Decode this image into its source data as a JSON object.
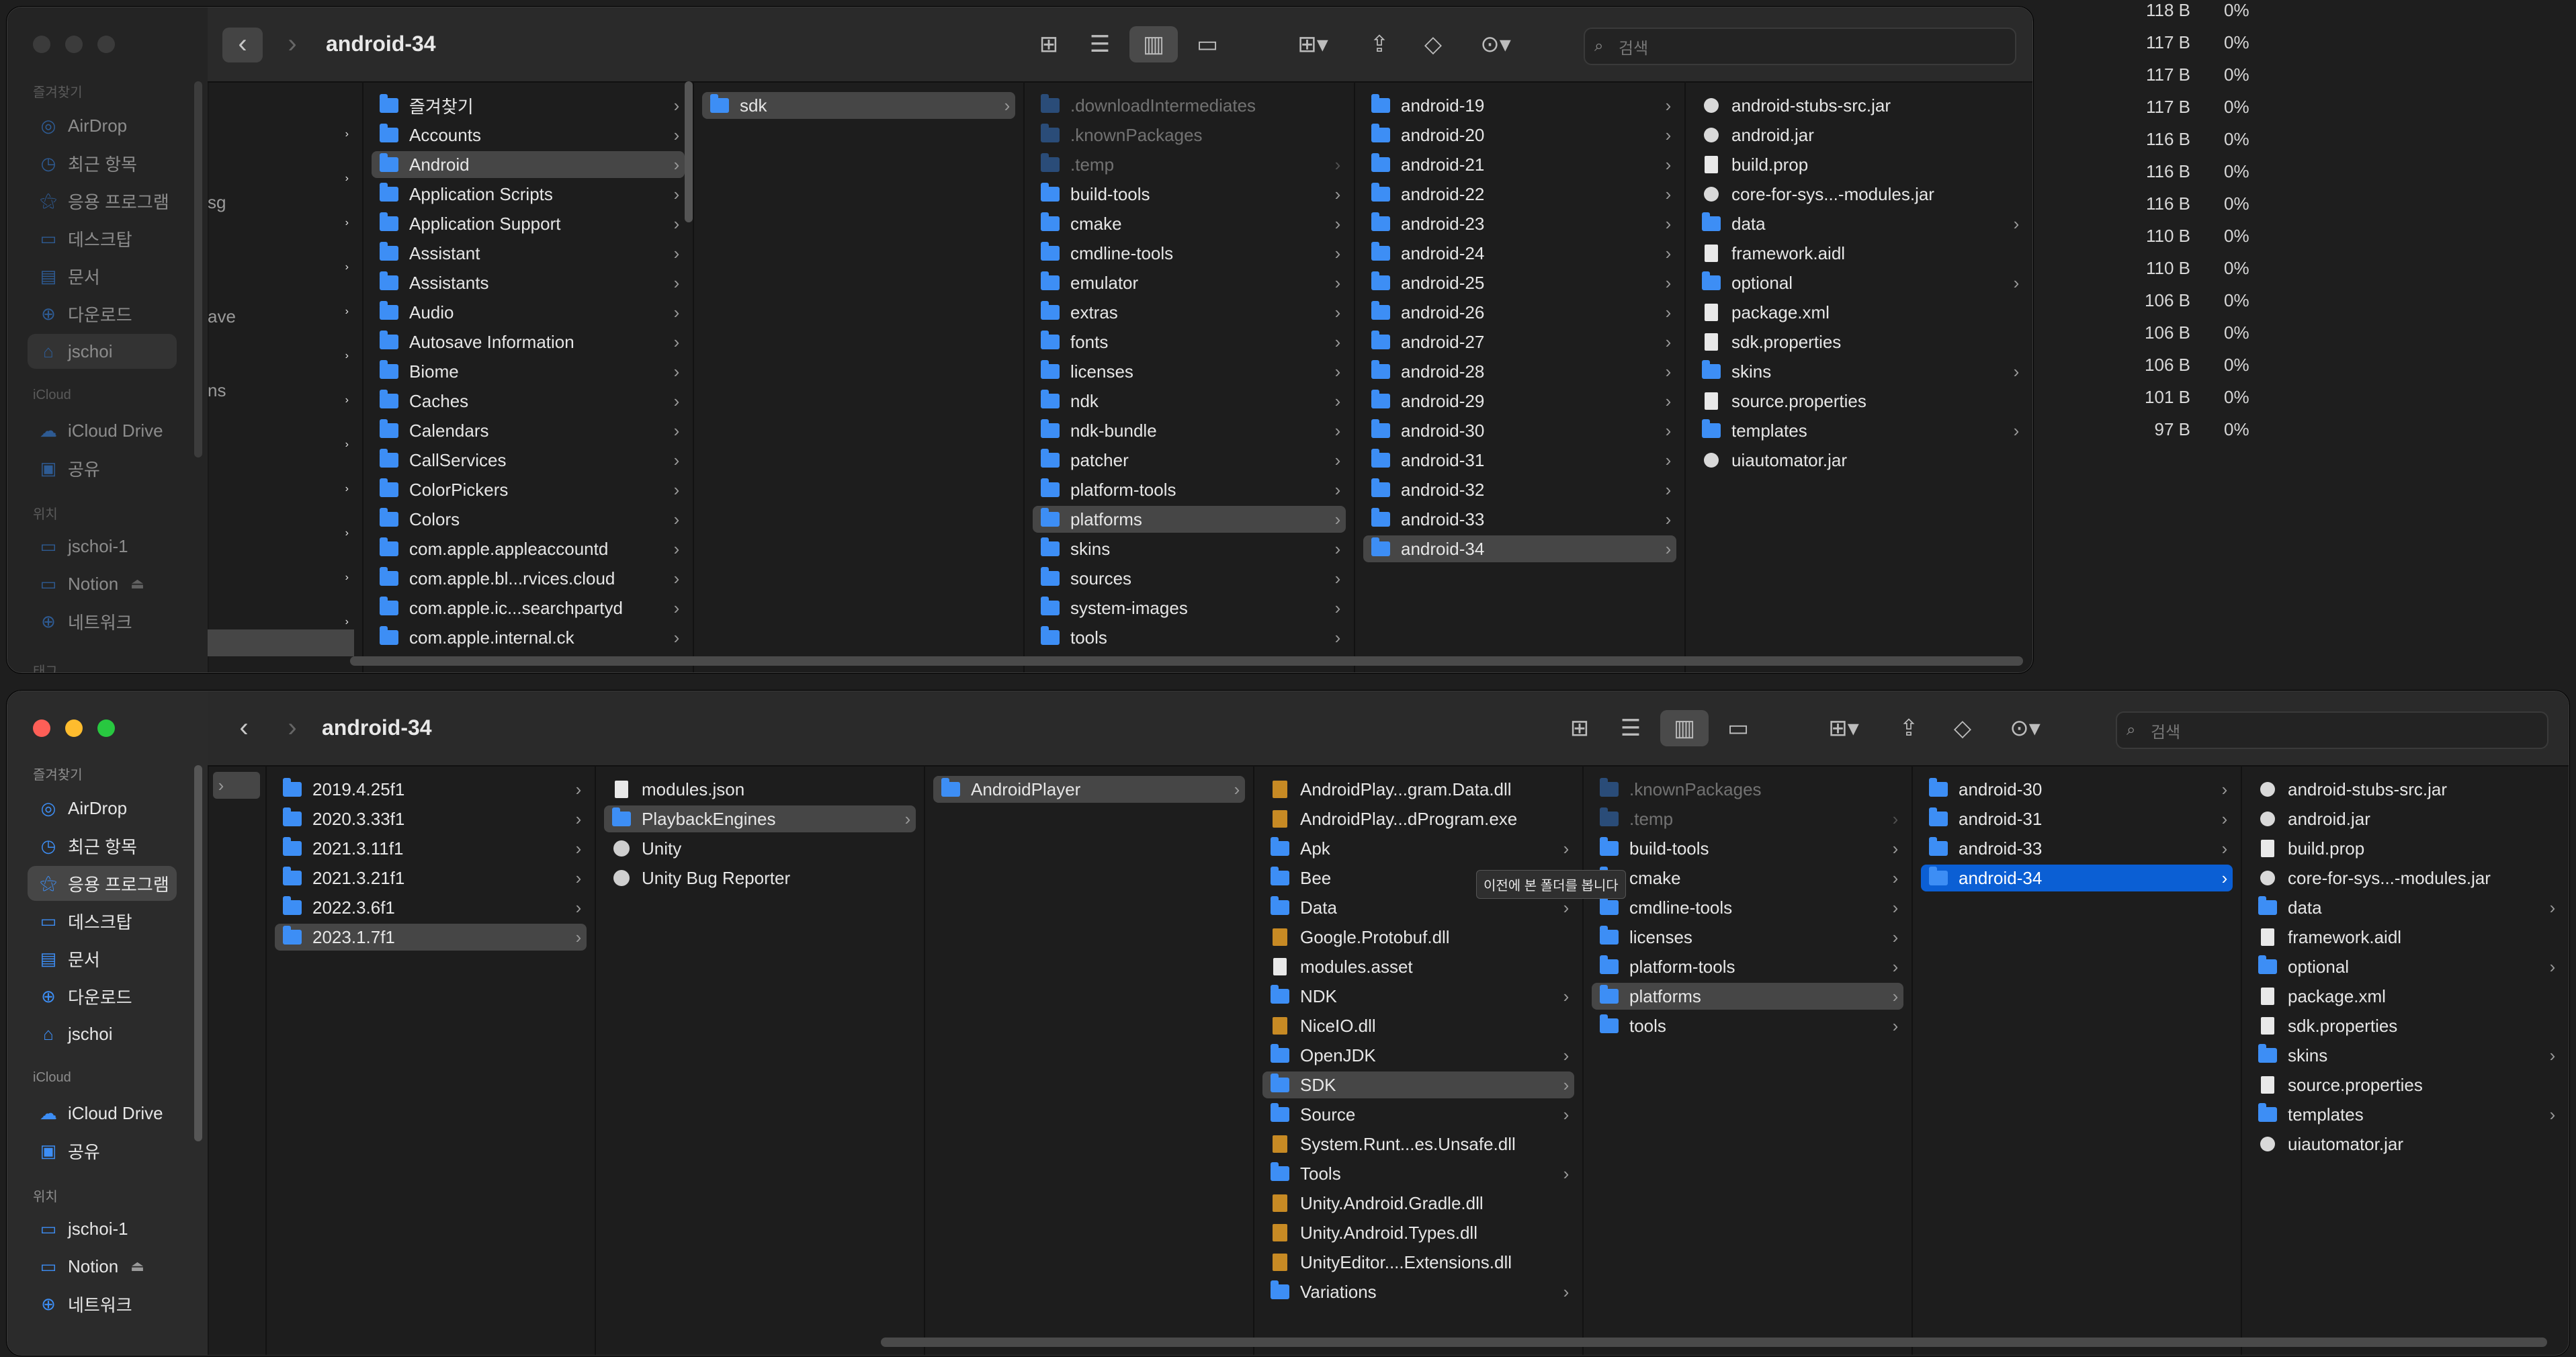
{
  "background_stats": {
    "rows": [
      {
        "size": "118 B",
        "pct": "0%"
      },
      {
        "size": "117 B",
        "pct": "0%"
      },
      {
        "size": "117 B",
        "pct": "0%"
      },
      {
        "size": "117 B",
        "pct": "0%"
      },
      {
        "size": "116 B",
        "pct": "0%"
      },
      {
        "size": "116 B",
        "pct": "0%"
      },
      {
        "size": "116 B",
        "pct": "0%"
      },
      {
        "size": "110 B",
        "pct": "0%"
      },
      {
        "size": "110 B",
        "pct": "0%"
      },
      {
        "size": "106 B",
        "pct": "0%"
      },
      {
        "size": "106 B",
        "pct": "0%"
      },
      {
        "size": "106 B",
        "pct": "0%"
      },
      {
        "size": "101 B",
        "pct": "0%"
      },
      {
        "size": "97 B",
        "pct": "0%"
      }
    ]
  },
  "top": {
    "title": "android-34",
    "search_placeholder": "검색",
    "sidebar": {
      "favorites_label": "즐겨찾기",
      "favorites": [
        "AirDrop",
        "최근 항목",
        "응용 프로그램",
        "데스크탑",
        "문서",
        "다운로드",
        "jschoi"
      ],
      "icloud_label": "iCloud",
      "icloud": [
        "iCloud Drive",
        "공유"
      ],
      "locations_label": "위치",
      "locations": [
        "jschoi-1",
        "Notion",
        "네트워크"
      ],
      "tags_label": "태그"
    },
    "col0_fragments": [
      "sg",
      "ave",
      "ns"
    ],
    "col1": [
      "즐겨찾기",
      "Accounts",
      "Android",
      "Application Scripts",
      "Application Support",
      "Assistant",
      "Assistants",
      "Audio",
      "Autosave Information",
      "Biome",
      "Caches",
      "Calendars",
      "CallServices",
      "ColorPickers",
      "Colors",
      "com.apple.appleaccountd",
      "com.apple.bl...rvices.cloud",
      "com.apple.ic...searchpartyd",
      "com.apple.internal.ck"
    ],
    "col2": [
      "sdk"
    ],
    "col3": [
      ".downloadIntermediates",
      ".knownPackages",
      ".temp",
      "build-tools",
      "cmake",
      "cmdline-tools",
      "emulator",
      "extras",
      "fonts",
      "licenses",
      "ndk",
      "ndk-bundle",
      "patcher",
      "platform-tools",
      "platforms",
      "skins",
      "sources",
      "system-images",
      "tools"
    ],
    "col4": [
      "android-19",
      "android-20",
      "android-21",
      "android-22",
      "android-23",
      "android-24",
      "android-25",
      "android-26",
      "android-27",
      "android-28",
      "android-29",
      "android-30",
      "android-31",
      "android-32",
      "android-33",
      "android-34"
    ],
    "col5": [
      "android-stubs-src.jar",
      "android.jar",
      "build.prop",
      "core-for-sys...-modules.jar",
      "data",
      "framework.aidl",
      "optional",
      "package.xml",
      "sdk.properties",
      "skins",
      "source.properties",
      "templates",
      "uiautomator.jar"
    ]
  },
  "bottom": {
    "title": "android-34",
    "search_placeholder": "검색",
    "sidebar": {
      "favorites_label": "즐겨찾기",
      "favorites": [
        "AirDrop",
        "최근 항목",
        "응용 프로그램",
        "데스크탑",
        "문서",
        "다운로드",
        "jschoi"
      ],
      "icloud_label": "iCloud",
      "icloud": [
        "iCloud Drive",
        "공유"
      ],
      "locations_label": "위치",
      "locations": [
        "jschoi-1",
        "Notion",
        "네트워크"
      ]
    },
    "col1": [
      "2019.4.25f1",
      "2020.3.33f1",
      "2021.3.11f1",
      "2021.3.21f1",
      "2022.3.6f1",
      "2023.1.7f1"
    ],
    "col2": [
      "modules.json",
      "PlaybackEngines",
      "Unity",
      "Unity Bug Reporter"
    ],
    "col3": [
      "AndroidPlayer"
    ],
    "col4": [
      "AndroidPlay...gram.Data.dll",
      "AndroidPlay...dProgram.exe",
      "Apk",
      "Bee",
      "Data",
      "Google.Protobuf.dll",
      "modules.asset",
      "NDK",
      "NiceIO.dll",
      "OpenJDK",
      "SDK",
      "Source",
      "System.Runt...es.Unsafe.dll",
      "Tools",
      "Unity.Android.Gradle.dll",
      "Unity.Android.Types.dll",
      "UnityEditor....Extensions.dll",
      "Variations"
    ],
    "col5": [
      ".knownPackages",
      ".temp",
      "build-tools",
      "cmake",
      "cmdline-tools",
      "licenses",
      "platform-tools",
      "platforms",
      "tools"
    ],
    "col6": [
      "android-30",
      "android-31",
      "android-33",
      "android-34"
    ],
    "col7": [
      "android-stubs-src.jar",
      "android.jar",
      "build.prop",
      "core-for-sys...-modules.jar",
      "data",
      "framework.aidl",
      "optional",
      "package.xml",
      "sdk.properties",
      "skins",
      "source.properties",
      "templates",
      "uiautomator.jar"
    ],
    "tooltip": "이전에 본 폴더를 봅니다"
  }
}
